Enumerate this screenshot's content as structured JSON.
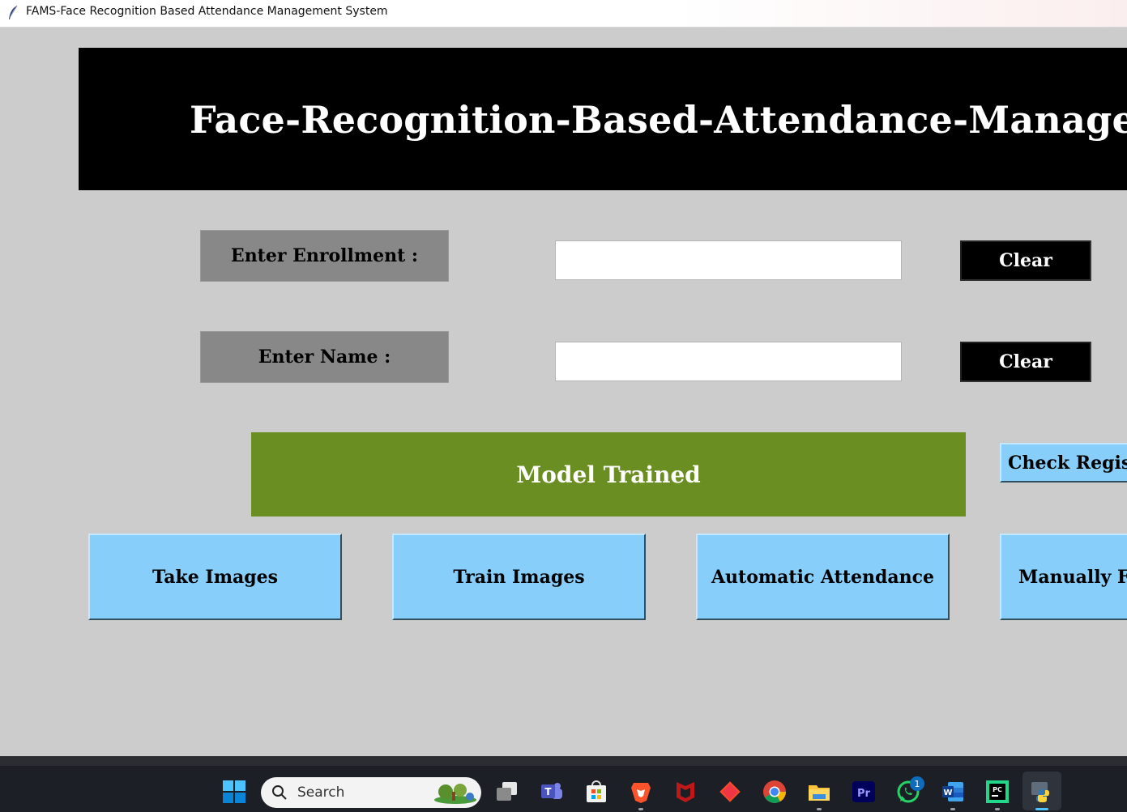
{
  "window": {
    "title": "FAMS-Face Recognition Based Attendance Management System",
    "app_icon": "feather-icon"
  },
  "banner": {
    "title": "Face-Recognition-Based-Attendance-Management-System"
  },
  "form": {
    "enrollment_label": "Enter Enrollment :",
    "enrollment_value": "",
    "name_label": "Enter Name :",
    "name_value": "",
    "clear_label": "Clear"
  },
  "status": {
    "message": "Model Trained",
    "color": "#6b8e23"
  },
  "buttons": {
    "check_registered": "Check Registered students",
    "take_images": "Take Images",
    "train_images": "Train Images",
    "automatic_attendance": "Automatic Attendance",
    "manually_fill": "Manually Fill Attendance"
  },
  "colors": {
    "background": "#cccccc",
    "banner": "#000000",
    "label_box": "#888888",
    "button_blue": "#87cefa"
  },
  "taskbar": {
    "search_placeholder": "Search",
    "whatsapp_badge": "1",
    "icons": [
      "windows-start-icon",
      "search-icon",
      "task-view-icon",
      "teams-icon",
      "store-icon",
      "brave-icon",
      "mcafee-icon",
      "git-icon",
      "chrome-icon",
      "file-explorer-icon",
      "premiere-icon",
      "whatsapp-icon",
      "word-icon",
      "pycharm-icon",
      "python-icon"
    ]
  }
}
